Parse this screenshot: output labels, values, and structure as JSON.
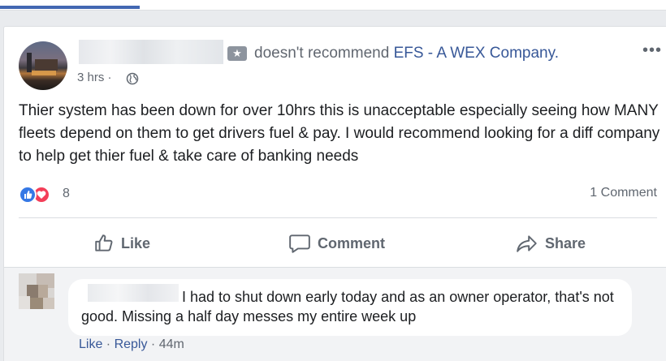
{
  "post": {
    "action_text": "doesn't recommend",
    "page_name": "EFS - A WEX Company.",
    "timestamp": "3 hrs ·",
    "body": "Thier system has been down for over 10hrs this is unacceptable especially seeing how MANY fleets depend on them to get drivers fuel & pay. I would recommend looking for a diff company to help get thier fuel & take care of banking needs",
    "reaction_count": "8",
    "comment_count": "1 Comment"
  },
  "actions": {
    "like": "Like",
    "comment": "Comment",
    "share": "Share"
  },
  "comment": {
    "text": "I had to shut down early today and as an owner operator, that's not good. Missing a half day messes my entire week up",
    "like_label": "Like",
    "separator": " · ",
    "reply_label": "Reply",
    "time": " · 44m"
  },
  "colors": {
    "facebook_blue": "#4267b2",
    "link_blue": "#385898",
    "like_blue": "#3578e5",
    "love_red": "#f33e58"
  },
  "icons": {
    "recommendation": "star-icon",
    "privacy": "globe-icon",
    "menu": "more-options-icon",
    "like": "thumbs-up-icon",
    "comment": "speech-bubble-icon",
    "share": "share-arrow-icon"
  }
}
